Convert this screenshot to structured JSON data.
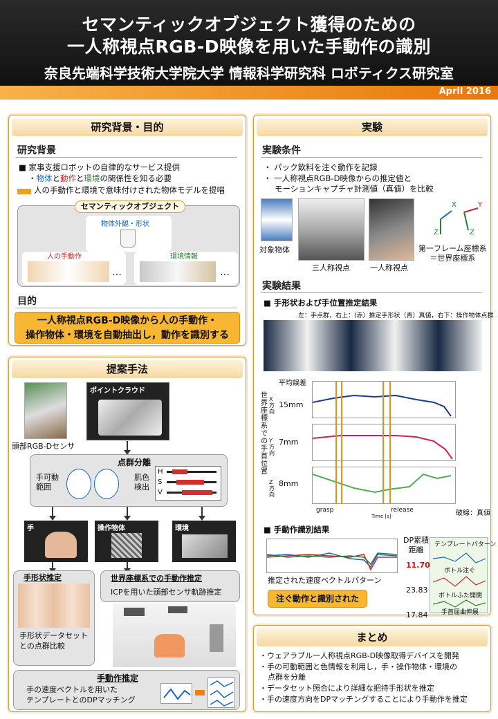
{
  "header": {
    "title1": "セマンティックオブジェクト獲得のための",
    "title2": "一人称視点RGB-D映像を用いた手動作の識別",
    "affiliation": "奈良先端科学技術大学院大学 情報科学研究科 ロボティクス研究室",
    "date": "April 2016"
  },
  "bg": {
    "title": "研究背景・目的",
    "sec1": "研究背景",
    "b1": "家事支援ロボットの自律的なサービス提供",
    "b2": "・物体と動作と環境の関係性を知る必要",
    "b2a": "物体",
    "b2b": "と",
    "b2c": "動作",
    "b2d": "と",
    "b2e": "環境",
    "b2f": "の関係性を知る必要",
    "b3": "人の手動作と環境で意味付けされた物体モデルを提唱",
    "semantic": "セマンティックオブジェクト",
    "appearance": "物体外観・形状",
    "hand": "人の手動作",
    "env": "環境情報",
    "dots": "…",
    "sec2": "目的",
    "goal1": "一人称視点RGB-D映像から人の手動作・",
    "goal2": "操作物体・環境を自動抽出し，動作を識別する"
  },
  "method": {
    "title": "提案手法",
    "cloud": "ポイントクラウド",
    "sensor": "頭部RGB-Dセンサ",
    "seg": "点群分離",
    "hand_range1": "手可動",
    "hand_range2": "範囲",
    "skin1": "肌色",
    "skin2": "検出",
    "h": "H",
    "s": "S",
    "v": "V",
    "hand": "手",
    "obj": "操作物体",
    "env": "環境",
    "shape": "手形状推定",
    "shape_desc1": "手形状データセット",
    "shape_desc2": "との点群比較",
    "world": "世界座標系での手動作推定",
    "icp": "ICPを用いた頭部センサ軌跡推定",
    "action": "手動作推定",
    "action_desc1": "手の速度ベクトルを用いた",
    "action_desc2": "テンプレートとのDPマッチング"
  },
  "exp": {
    "title": "実験",
    "sec1": "実験条件",
    "c1": "パック飲料を注ぐ動作を記録",
    "c2": "一人称視点RGB-D映像からの推定値と",
    "c3": "モーションキャプチャ計測値（真値）を比較",
    "target": "対象物体",
    "third": "三人称視点",
    "first": "一人称視点",
    "frame1": "第一フレーム座標系",
    "frame2": "＝世界座標系",
    "x": "X",
    "y": "Y",
    "z": "Z",
    "sec2": "実験結果",
    "r1": "手形状および手位置推定結果",
    "legend": "左：手点群，右上：(赤）推定手形状（青）真値，右下：操作物体点群",
    "avg_err": "平均誤差",
    "e1": "15mm",
    "e2": "7mm",
    "e3": "8mm",
    "yaxis": "世界座標系での手首位置",
    "xdir": "X方向",
    "ydir": "Y方向",
    "zdir": "Z方向",
    "grasp": "grasp",
    "release": "release",
    "truth": "破線：真値",
    "time": "Time [s]",
    "pos": "Position [m]",
    "r2": "手動作識別結果",
    "dp": "DP累積",
    "dist": "距離",
    "tpl": "テンプレートパターン",
    "d1": "11.70",
    "d2": "23.83",
    "d3": "17.84",
    "p1": "ボトル注ぐ",
    "p2": "ボトルふた開閉",
    "p3": "手首屈曲伸展",
    "est": "推定された速度ベクトルパターン",
    "result": "注ぐ動作と識別された",
    "frame": "Frame",
    "vel": "Velocity [m/frame]"
  },
  "sum": {
    "title": "まとめ",
    "s1": "ウェアラブル一人称視点RGB-D映像取得デバイスを開発",
    "s2": "手の可動範囲と色情報を利用し，手・操作物体・環境の",
    "s2b": "点群を分離",
    "s3": "データセット照合により詳細な把持手形状を推定",
    "s4": "手の速度方向をDPマッチングすることにより手動作を推定"
  },
  "colors": {
    "accent": "#e8780a",
    "box": "#f7b733",
    "red": "#cc1111"
  }
}
